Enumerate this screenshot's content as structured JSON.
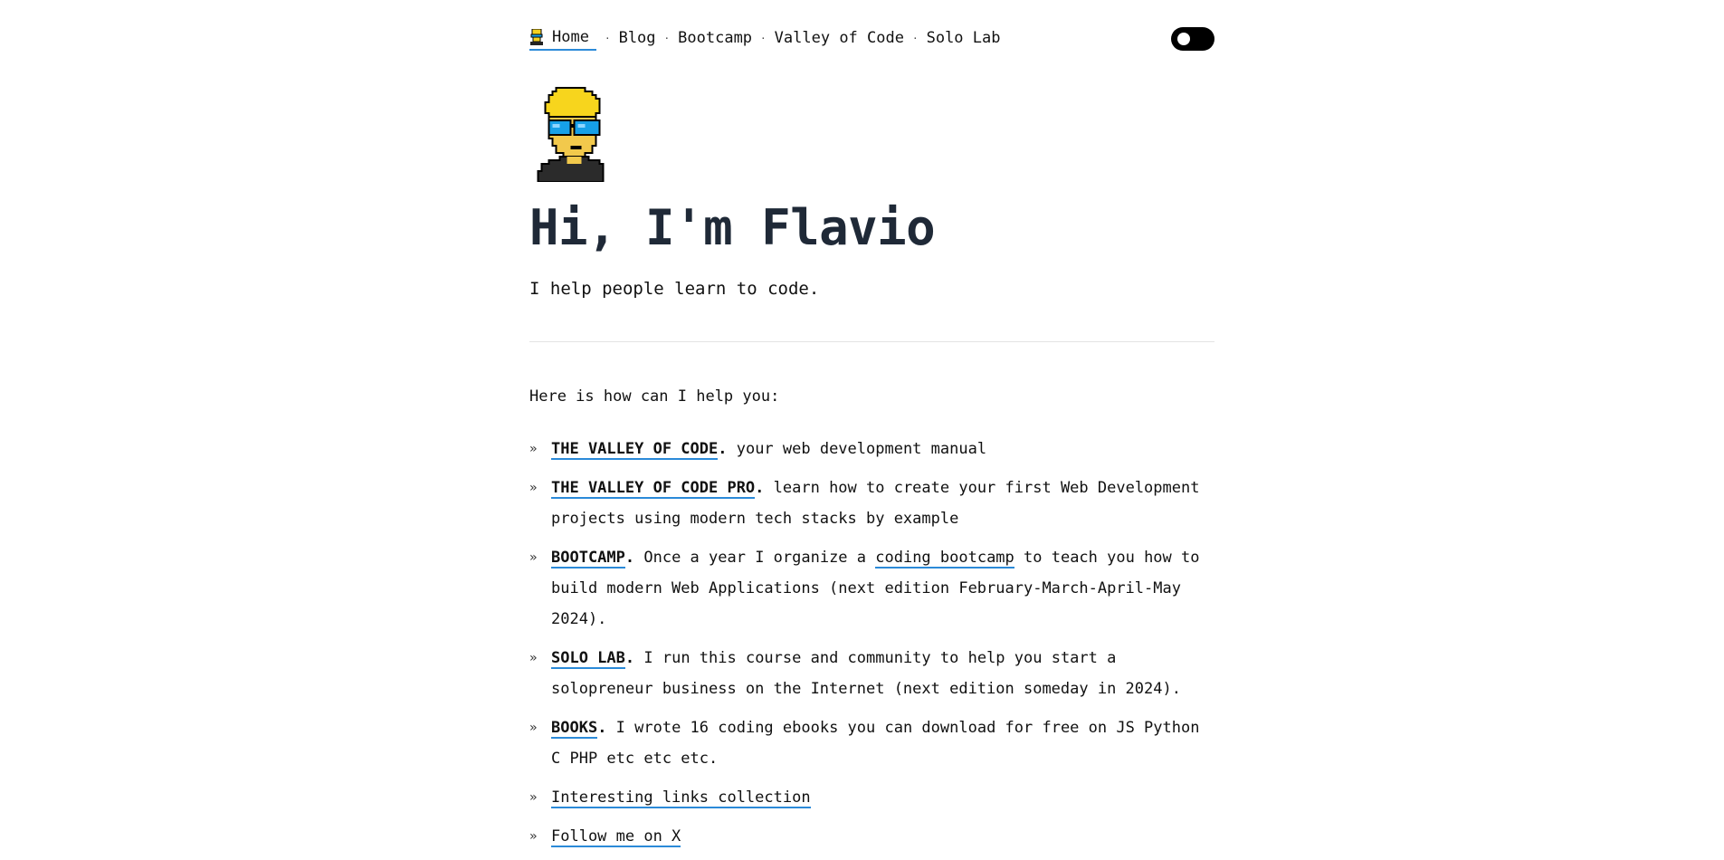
{
  "nav": {
    "items": [
      {
        "label": "Home",
        "active": true
      },
      {
        "label": "Blog"
      },
      {
        "label": "Bootcamp"
      },
      {
        "label": "Valley of Code"
      },
      {
        "label": "Solo Lab"
      }
    ],
    "separator": "·",
    "theme_toggle_state": "dark-off"
  },
  "hero": {
    "title": "Hi, I'm Flavio",
    "subtitle": "I help people learn to code."
  },
  "intro": "Here is how can I help you:",
  "bullet": "»",
  "items": [
    {
      "label": "THE VALLEY OF CODE",
      "dot": ".",
      "text": " your web development manual"
    },
    {
      "label": "THE VALLEY OF CODE PRO",
      "dot": ".",
      "text": " learn how to create your first Web Development projects using modern tech stacks by example"
    },
    {
      "label": "BOOTCAMP",
      "dot": ".",
      "text_before": " Once a year I organize a ",
      "inline_link": "coding bootcamp",
      "text_after": " to teach you how to build modern Web Applications (next edition February-March-April-May 2024)."
    },
    {
      "label": "SOLO LAB",
      "dot": ".",
      "text": " I run this course and community to help you start a solopreneur business on the Internet (next edition someday in 2024)."
    },
    {
      "label": "BOOKS",
      "dot": ".",
      "text": " I wrote 16 coding ebooks you can download for free on JS Python C PHP etc etc etc."
    },
    {
      "link": "Interesting links collection"
    },
    {
      "link": "Follow me on X"
    }
  ],
  "colors": {
    "accent_underline": "#2b8ad8",
    "title": "#1f2937",
    "toggle_bg": "#000000"
  }
}
